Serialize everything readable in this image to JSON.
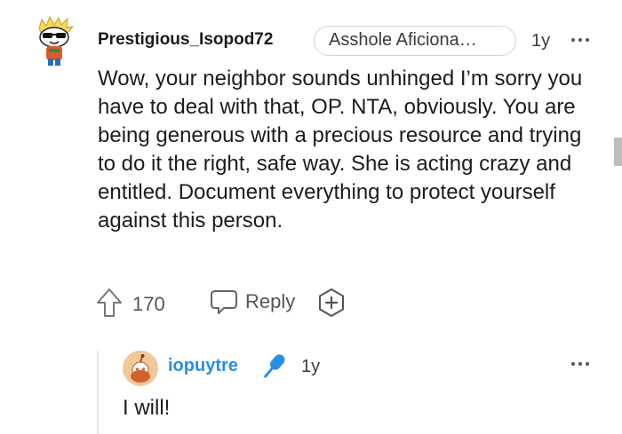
{
  "comment": {
    "username": "Prestigious_Isopod72",
    "flair": "Asshole Aficiona…",
    "timestamp": "1y",
    "body": "Wow, your neighbor sounds unhinged I’m sorry you have to deal with that, OP. NTA, obviously. You are being generous with a precious resource and trying to do it the right, safe way. She is acting crazy and entitled. Document everything to protect yourself against this person.",
    "score": "170",
    "reply_label": "Reply",
    "icons": {
      "avatar": "snoo-avatar-sunglasses",
      "upvote": "upvote-arrow-icon",
      "reply": "speech-bubble-icon",
      "award": "award-plus-icon",
      "more": "ellipsis-icon"
    }
  },
  "reply": {
    "username": "iopuytre",
    "timestamp": "1y",
    "body": "I will!",
    "icons": {
      "avatar": "snoo-avatar-orange",
      "badge": "microphone-icon",
      "more": "ellipsis-icon"
    }
  },
  "colors": {
    "username_reply": "#2a8fe0",
    "text": "#1c1c1c",
    "muted": "#555555",
    "border": "#cfd3d6"
  }
}
